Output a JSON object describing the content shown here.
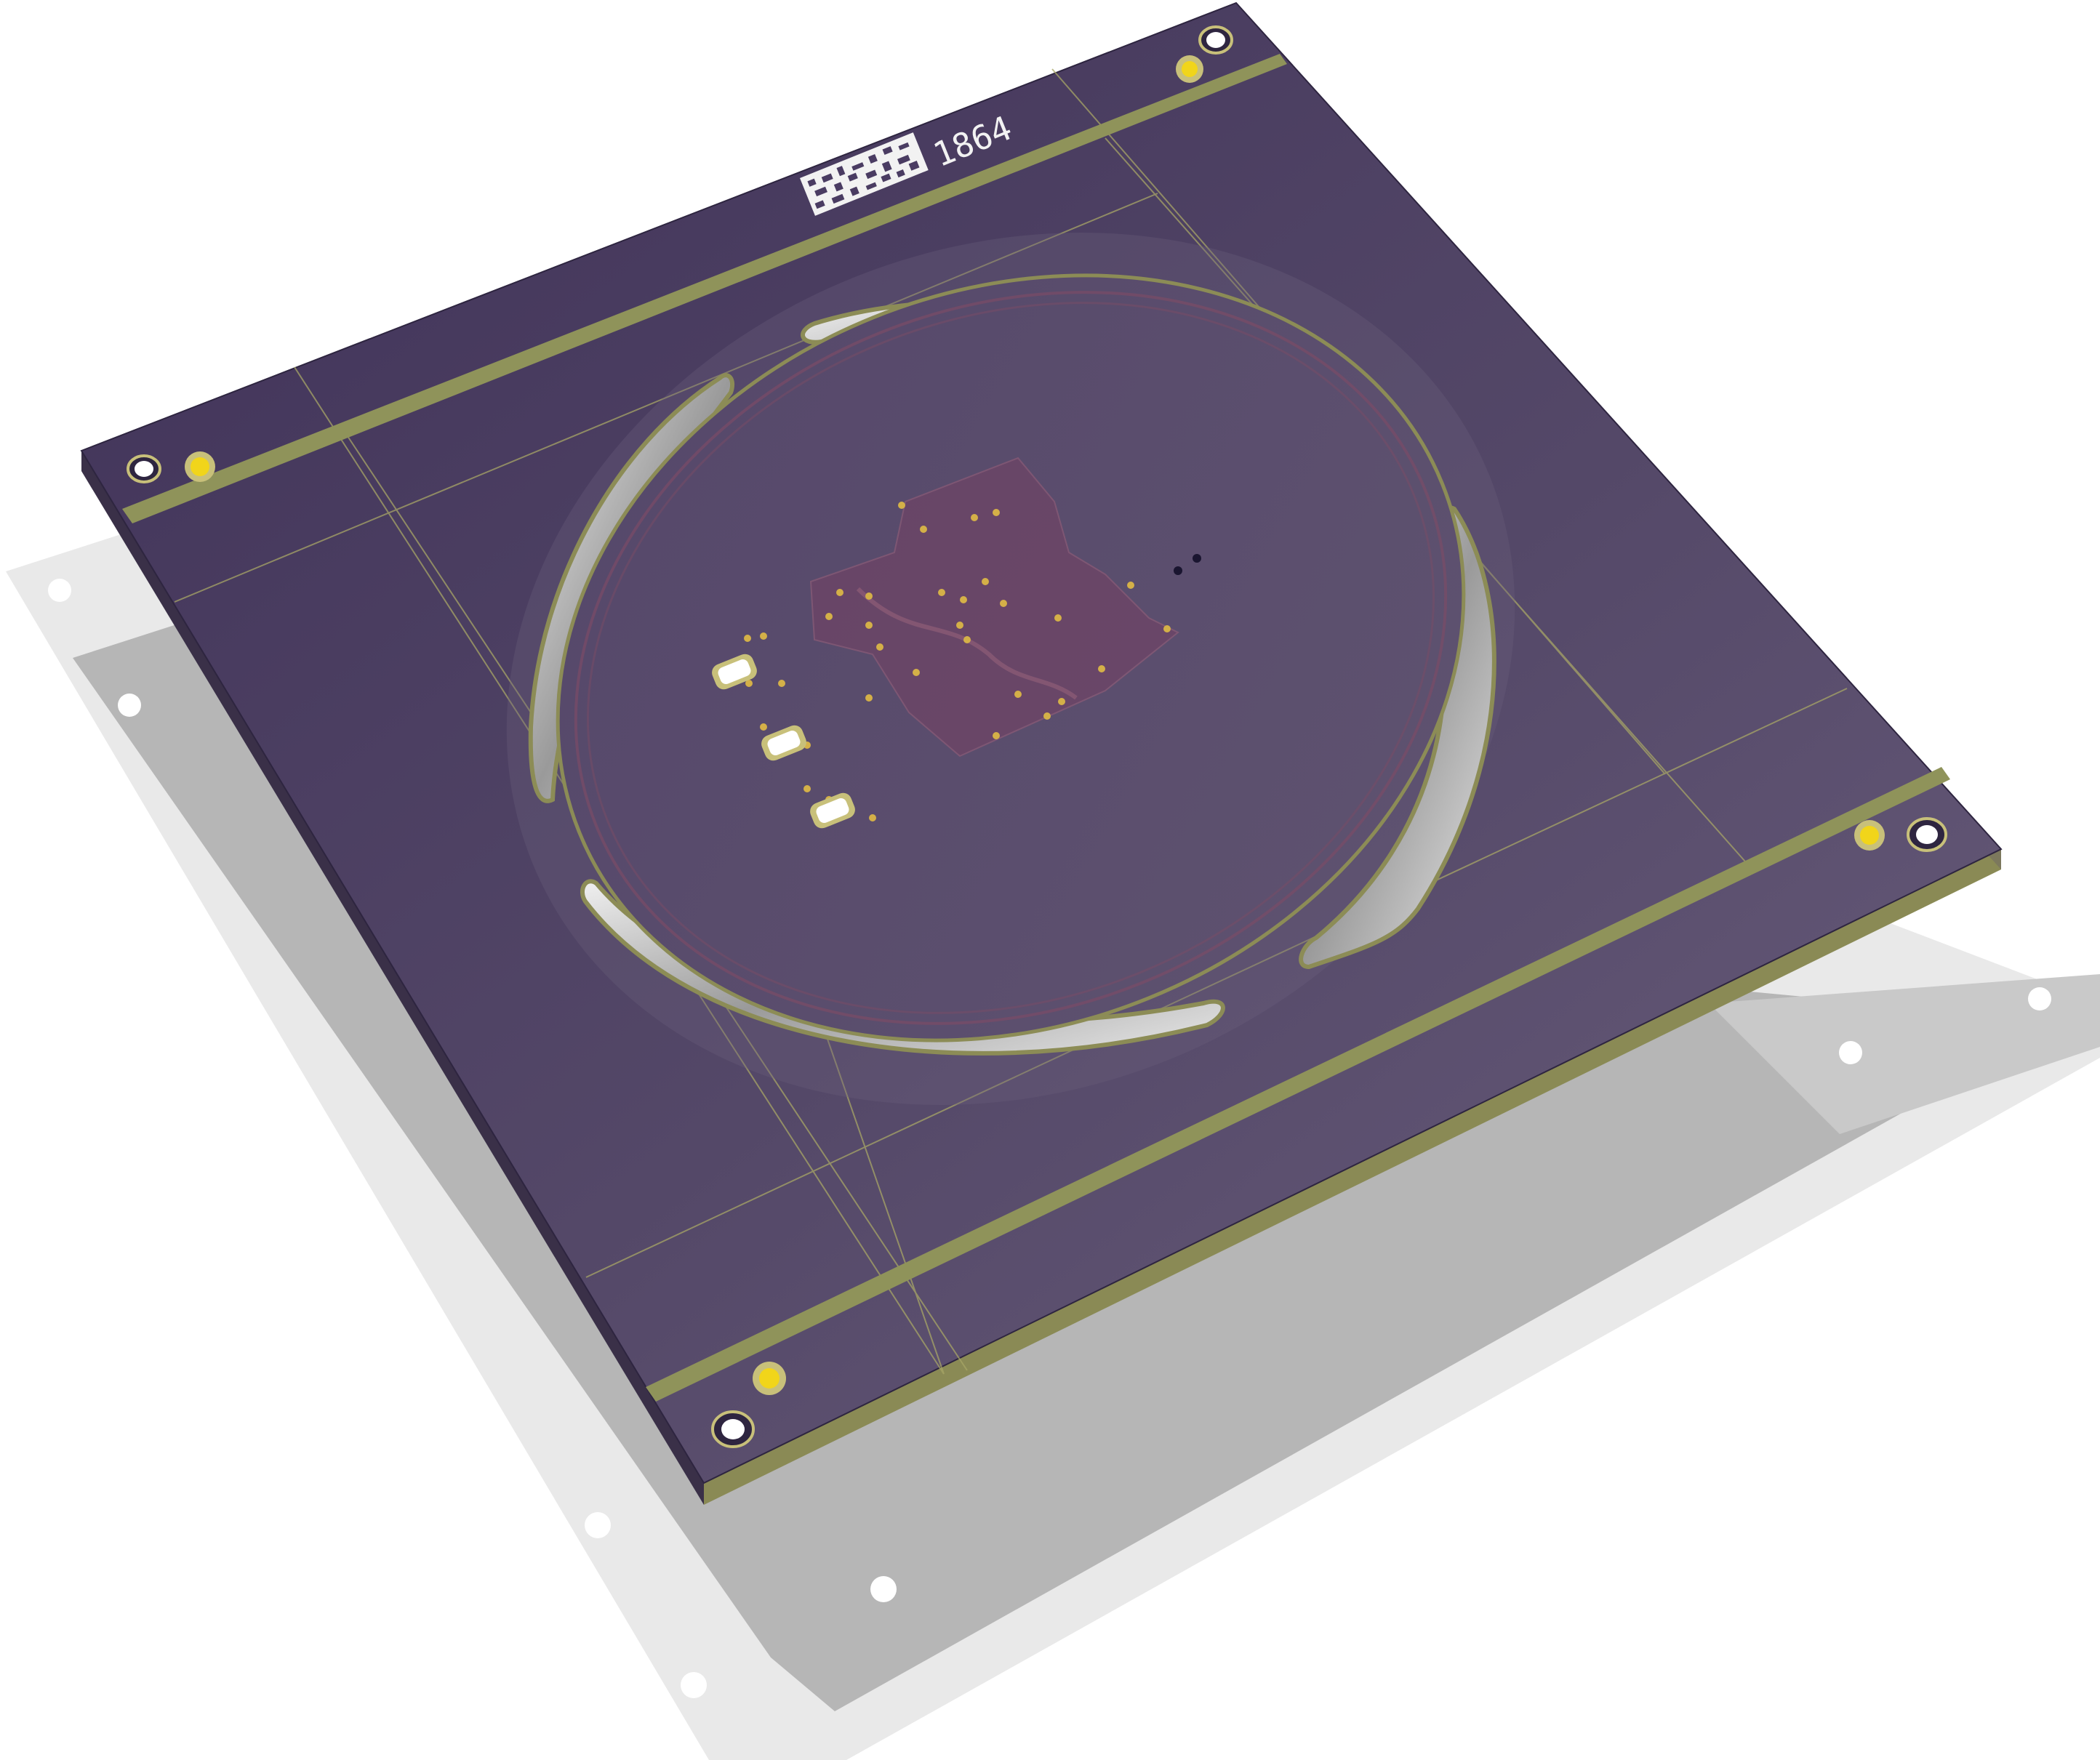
{
  "board": {
    "serial_label": "1864",
    "colors": {
      "background": "#ffffff",
      "shadow": "#b4b4b4",
      "shadow_light": "#e6e6e6",
      "substrate_top": "#4a3c62",
      "substrate_bottom": "#665a78",
      "edge": "#8c8c56",
      "copper_strip": "#8f935a",
      "silkscreen": "#f2f2f2",
      "gold_pad": "#f1d51a",
      "mounting_hole_ring": "#c8c07a",
      "cutout_interior": "#d8d8d8",
      "inner_disc": "#5a4c6c",
      "inner_traces": "#7a4c66",
      "outline_lines": "#a7a566"
    },
    "icons": [
      "datamatrix-code-icon",
      "mounting-hole-icon",
      "gold-pad-icon",
      "smd-slot-icon",
      "via-icon"
    ]
  }
}
